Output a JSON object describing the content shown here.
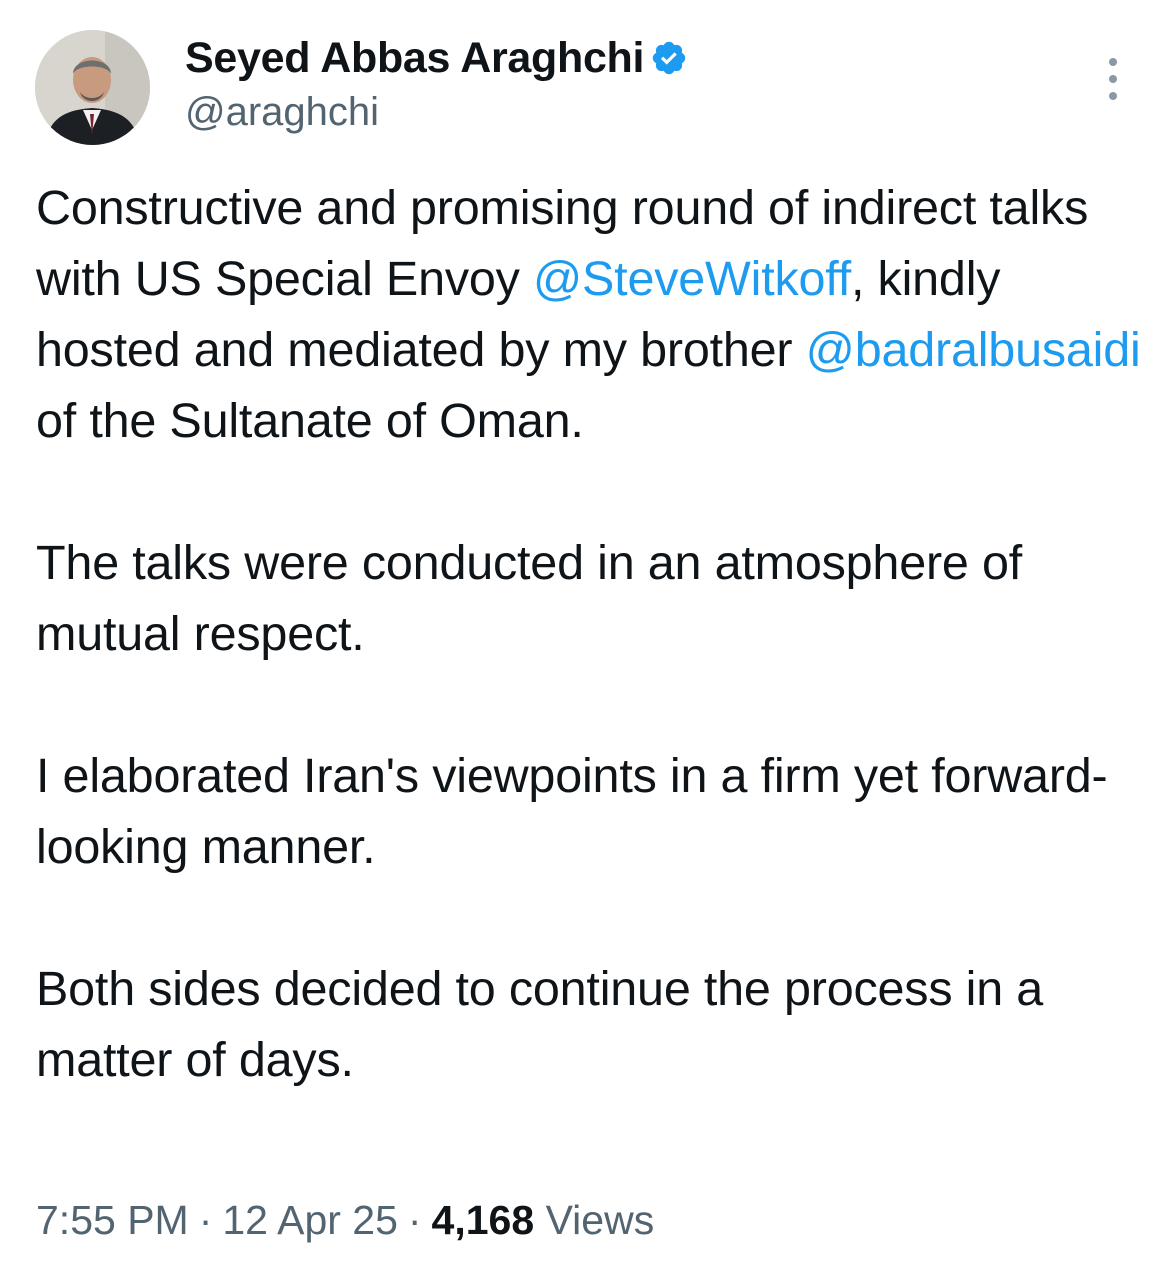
{
  "author": {
    "display_name": "Seyed Abbas Araghchi",
    "handle": "@araghchi",
    "verified_icon": "verified-badge-icon",
    "avatar_icon": "profile-photo"
  },
  "menu": {
    "icon": "more-options-icon"
  },
  "tweet": {
    "p1": {
      "t1": "Constructive and promising round of indirect talks with US Special Envoy ",
      "m1": "@SteveWitkoff",
      "t2": ", kindly hosted and mediated by my brother ",
      "m2": "@badralbusaidi",
      "t3": " of the Sultanate of Oman."
    },
    "p2": "The talks were conducted in an atmosphere of mutual respect.",
    "p3": "I elaborated Iran's viewpoints in a firm yet forward-looking manner.",
    "p4": "Both sides decided to continue the process in a matter of days."
  },
  "meta": {
    "time": "7:55 PM",
    "separator": "·",
    "date": "12 Apr 25",
    "views_count": "4,168",
    "views_label": "Views"
  },
  "colors": {
    "link": "#1d9bf0",
    "text": "#0f1419",
    "secondary": "#536471"
  }
}
